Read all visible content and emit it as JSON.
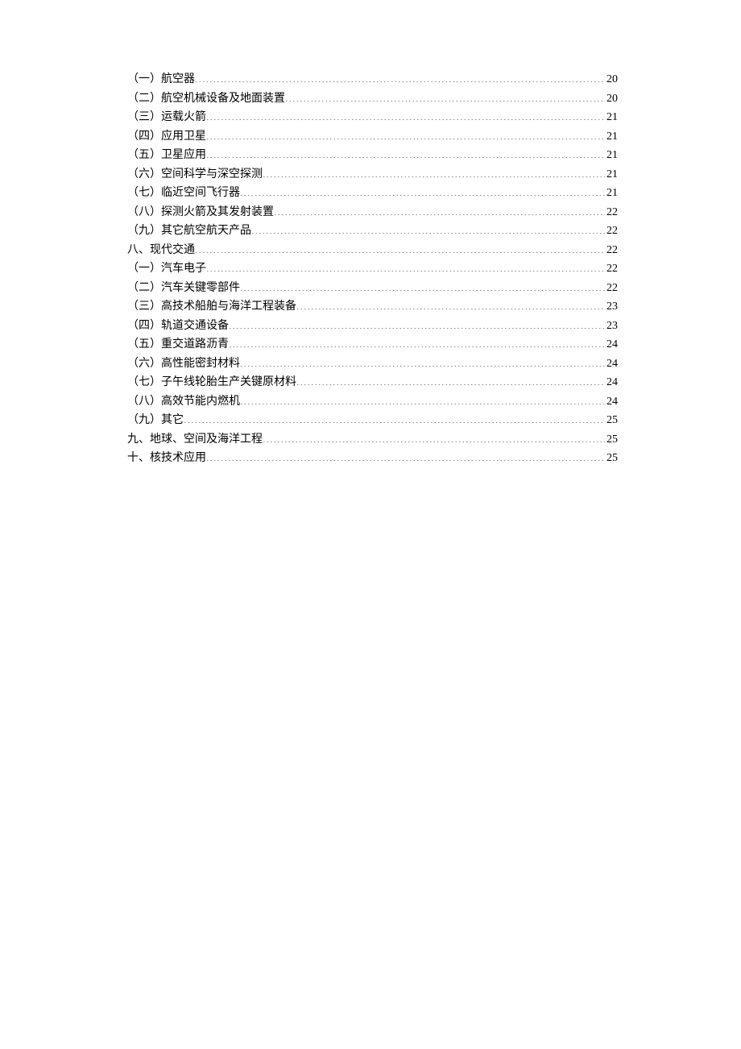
{
  "toc": {
    "entries": [
      {
        "label": "（一）航空器",
        "page": "20"
      },
      {
        "label": "（二）航空机械设备及地面装置",
        "page": "20"
      },
      {
        "label": "（三）运载火箭",
        "page": "21"
      },
      {
        "label": "（四）应用卫星",
        "page": "21"
      },
      {
        "label": "（五）卫星应用",
        "page": "21"
      },
      {
        "label": "（六）空间科学与深空探测",
        "page": "21"
      },
      {
        "label": "（七）临近空间飞行器",
        "page": "21"
      },
      {
        "label": "（八）探测火箭及其发射装置",
        "page": "22"
      },
      {
        "label": "（九）其它航空航天产品",
        "page": "22"
      },
      {
        "label": "八、现代交通",
        "page": "22"
      },
      {
        "label": "（一）汽车电子",
        "page": "22"
      },
      {
        "label": "（二）汽车关键零部件",
        "page": "22"
      },
      {
        "label": "（三）高技术船舶与海洋工程装备",
        "page": "23"
      },
      {
        "label": "（四）轨道交通设备",
        "page": "23"
      },
      {
        "label": "（五）重交道路沥青",
        "page": "24"
      },
      {
        "label": "（六）高性能密封材料",
        "page": "24"
      },
      {
        "label": "（七）子午线轮胎生产关键原材料",
        "page": "24"
      },
      {
        "label": "（八）高效节能内燃机",
        "page": "24"
      },
      {
        "label": "（九）其它",
        "page": "25"
      },
      {
        "label": "九、地球、空间及海洋工程",
        "page": "25"
      },
      {
        "label": "十、核技术应用",
        "page": "25"
      }
    ]
  }
}
